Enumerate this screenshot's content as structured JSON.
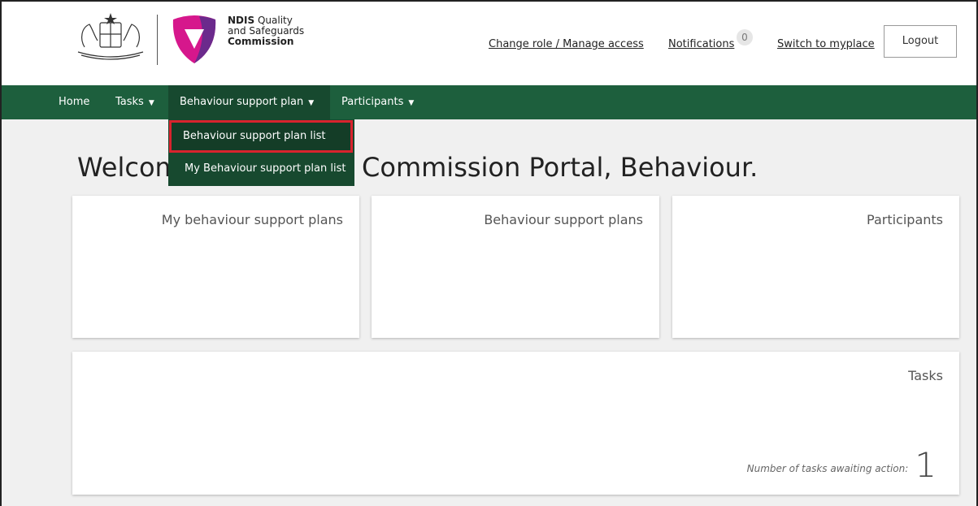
{
  "header": {
    "logo_text": [
      "NDIS",
      "Quality",
      "and Safeguards",
      "Commission"
    ],
    "links": {
      "change_role": "Change role / Manage access",
      "notifications": "Notifications",
      "notifications_count": "0",
      "switch": "Switch to myplace"
    },
    "logout_label": "Logout"
  },
  "nav": {
    "items": [
      {
        "label": "Home"
      },
      {
        "label": "Tasks"
      },
      {
        "label": "Behaviour support plan"
      },
      {
        "label": "Participants"
      }
    ],
    "dropdown": {
      "items": [
        {
          "label": "Behaviour support plan list"
        },
        {
          "label": "My Behaviour support plan list"
        }
      ]
    }
  },
  "main": {
    "welcome": "Welcome to the NDIS Commission Portal, Behaviour.",
    "cards": [
      {
        "title": "My behaviour support plans"
      },
      {
        "title": "Behaviour support plans"
      },
      {
        "title": "Participants"
      }
    ],
    "tasks": {
      "title": "Tasks",
      "awaiting_label": "Number of tasks awaiting action:",
      "count": "1"
    }
  },
  "colors": {
    "nav_bg": "#1d5f3d",
    "nav_active": "#17492f",
    "highlight": "#d9232e",
    "logo_magenta": "#d6178c",
    "logo_purple": "#6b2a8c"
  }
}
